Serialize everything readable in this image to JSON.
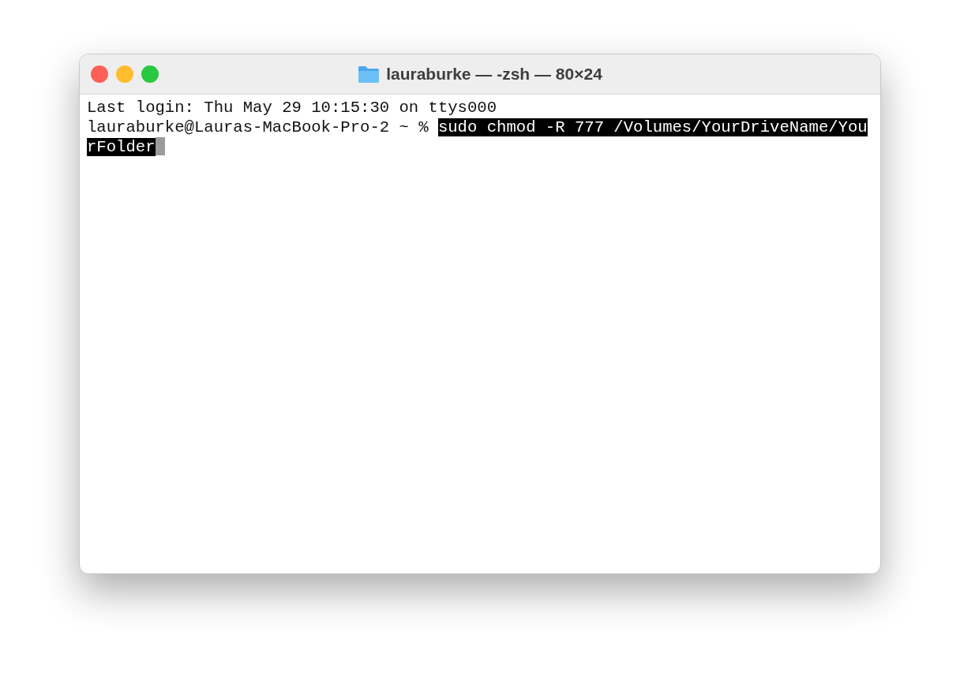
{
  "window": {
    "title": "lauraburke — -zsh — 80×24"
  },
  "terminal": {
    "lines": [
      {
        "kind": "output",
        "text": "Last login: Thu May 29 10:15:30 on ttys000"
      },
      {
        "kind": "prompt",
        "prompt": "lauraburke@Lauras-MacBook-Pro-2 ~ % ",
        "command": "sudo chmod -R 777 /Volumes/YourDriveName/YourFolder",
        "selected": true
      }
    ]
  }
}
